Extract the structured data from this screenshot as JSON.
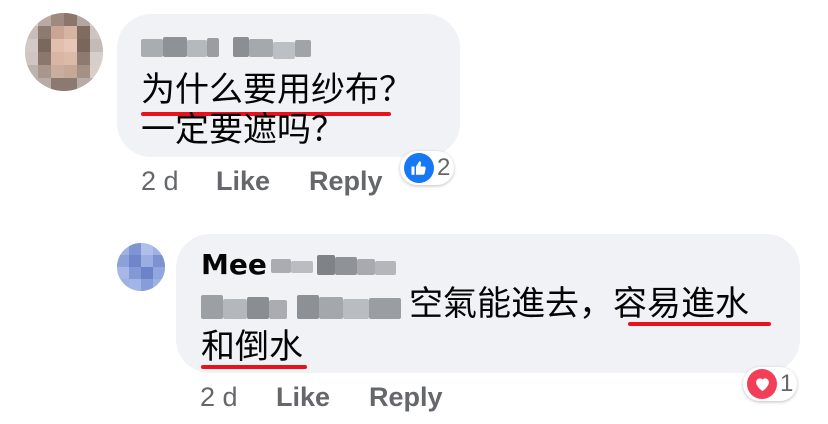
{
  "comment1": {
    "avatar_icon": "user-avatar-blurred",
    "body_line1": "为什么要用纱布？",
    "body_line2": "一定要遮吗？",
    "timestamp": "2 d",
    "like_label": "Like",
    "reply_label": "Reply",
    "reaction": {
      "icon": "like-thumb-icon",
      "color": "#1877f2",
      "count": "2"
    }
  },
  "comment2": {
    "avatar_icon": "user-avatar-blurred",
    "author_visible": "Mee",
    "body_visible_line1": "空氣能進去，容易進水",
    "body_line2": "和倒水",
    "timestamp": "2 d",
    "like_label": "Like",
    "reply_label": "Reply",
    "reaction": {
      "icon": "heart-icon",
      "color": "#f33e58",
      "count": "1"
    }
  },
  "colors": {
    "bubble_bg": "#f0f2f5",
    "text": "#050505",
    "meta_text": "#65676b",
    "annotation_underline": "#e8121d"
  }
}
